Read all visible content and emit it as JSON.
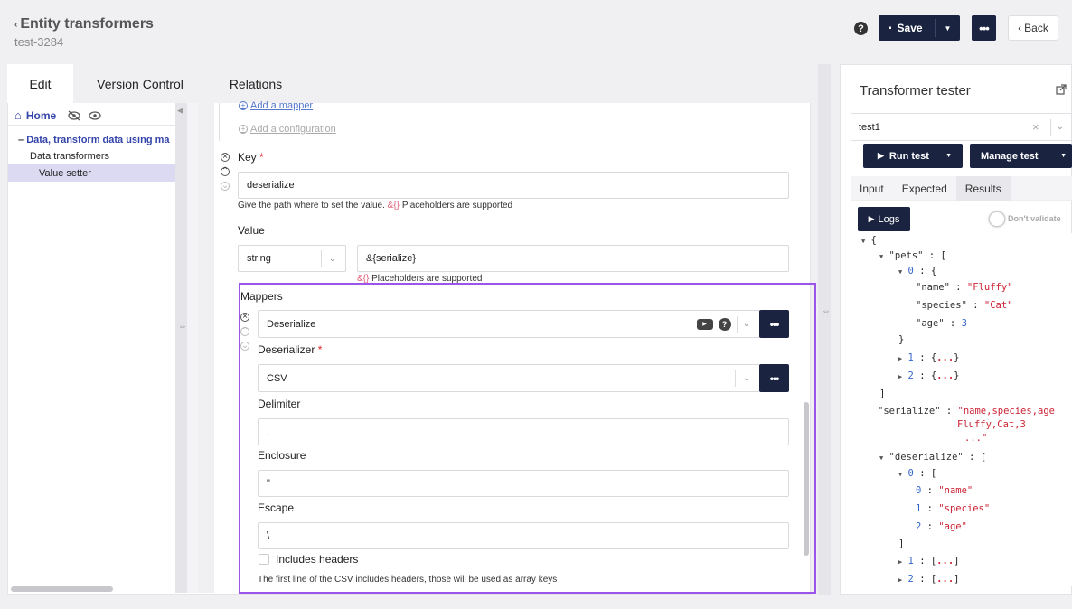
{
  "header": {
    "title": "Entity transformers",
    "subtitle": "test-3284",
    "help": "?",
    "save_label": "Save",
    "back_label": "Back"
  },
  "tabs": [
    "Edit",
    "Version Control",
    "Relations"
  ],
  "tree": {
    "home": "Home",
    "items": [
      "Data, transform data using ma",
      "Data transformers",
      "Value setter"
    ]
  },
  "form": {
    "add_mapper": "Add a mapper",
    "add_configuration": "Add a configuration",
    "key_label": "Key",
    "key_value": "deserialize",
    "key_hint_pre": "Give the path where to set the value.",
    "placeholder_token": "&{}",
    "placeholders_supported": "Placeholders are supported",
    "value_label": "Value",
    "value_type": "string",
    "value_value": "&{serialize}",
    "mappers_label": "Mappers",
    "mapper_name": "Deserialize",
    "deserializer_label": "Deserializer",
    "deserializer_value": "CSV",
    "delimiter_label": "Delimiter",
    "delimiter_value": ",",
    "enclosure_label": "Enclosure",
    "enclosure_value": "\"",
    "escape_label": "Escape",
    "escape_value": "\\",
    "includes_headers_label": "Includes headers",
    "includes_headers_hint": "The first line of the CSV includes headers, those will be used as array keys",
    "required_mark": "*"
  },
  "tester": {
    "title": "Transformer tester",
    "test_name": "test1",
    "run_label": "Run test",
    "manage_label": "Manage test",
    "subtabs": [
      "Input",
      "Expected",
      "Results"
    ],
    "logs_label": "Logs",
    "dont_validate": "Don't validate",
    "json": {
      "pets_key": "\"pets\"",
      "idx0": "0",
      "name_key": "\"name\"",
      "name_val": "\"Fluffy\"",
      "species_key": "\"species\"",
      "species_val": "\"Cat\"",
      "age_key": "\"age\"",
      "age_val": "3",
      "idx1": "1",
      "idx2": "2",
      "serialize_key": "\"serialize\"",
      "serialize_val_1": "\"name,species,age",
      "serialize_val_2": "Fluffy,Cat,3",
      "serialize_val_3": "...\"",
      "deserialize_key": "\"deserialize\"",
      "d0": "0",
      "d1": "1",
      "d2": "2",
      "dv0": "\"name\"",
      "dv1": "\"species\"",
      "dv2": "\"age\"",
      "ellipsis": "..."
    }
  }
}
